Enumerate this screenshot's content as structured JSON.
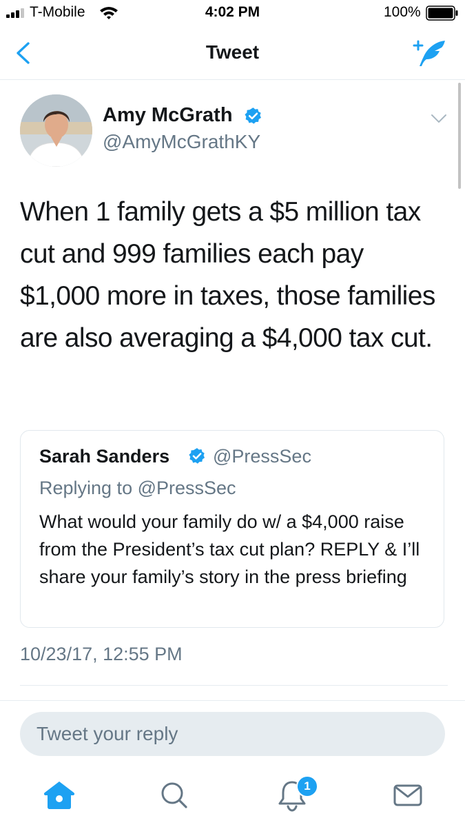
{
  "status_bar": {
    "carrier": "T-Mobile",
    "time": "4:02 PM",
    "battery": "100%",
    "icons": [
      "signal-icon",
      "wifi-icon",
      "battery-icon"
    ]
  },
  "nav": {
    "title": "Tweet",
    "left_icon": "back-chevron-icon",
    "right_icon": "compose-tweet-icon"
  },
  "tweet": {
    "author_name": "Amy McGrath",
    "author_handle": "@AmyMcGrathKY",
    "verified": true,
    "text": "When 1 family gets a $5 million tax cut and 999 families each pay $1,000 more in taxes, those families are also averaging a $4,000 tax cut.",
    "timestamp": "10/23/17, 12:55 PM"
  },
  "quoted_tweet": {
    "author_name": "Sarah Sanders",
    "author_handle": "@PressSec",
    "verified": true,
    "replying_to": "Replying to @PressSec",
    "text": "What would your family do w/ a $4,000 raise from the President’s tax cut plan? REPLY & I’ll share your family’s story in the press briefing"
  },
  "reply": {
    "placeholder": "Tweet your reply"
  },
  "tab_bar": {
    "tabs": [
      "home-icon",
      "search-icon",
      "notifications-icon",
      "messages-icon"
    ],
    "notification_count": "1"
  },
  "colors": {
    "accent": "#1da1f2",
    "text_primary": "#14171a",
    "text_secondary": "#657786",
    "border": "#e1e8ed",
    "reply_bg": "#e6ecf0"
  }
}
